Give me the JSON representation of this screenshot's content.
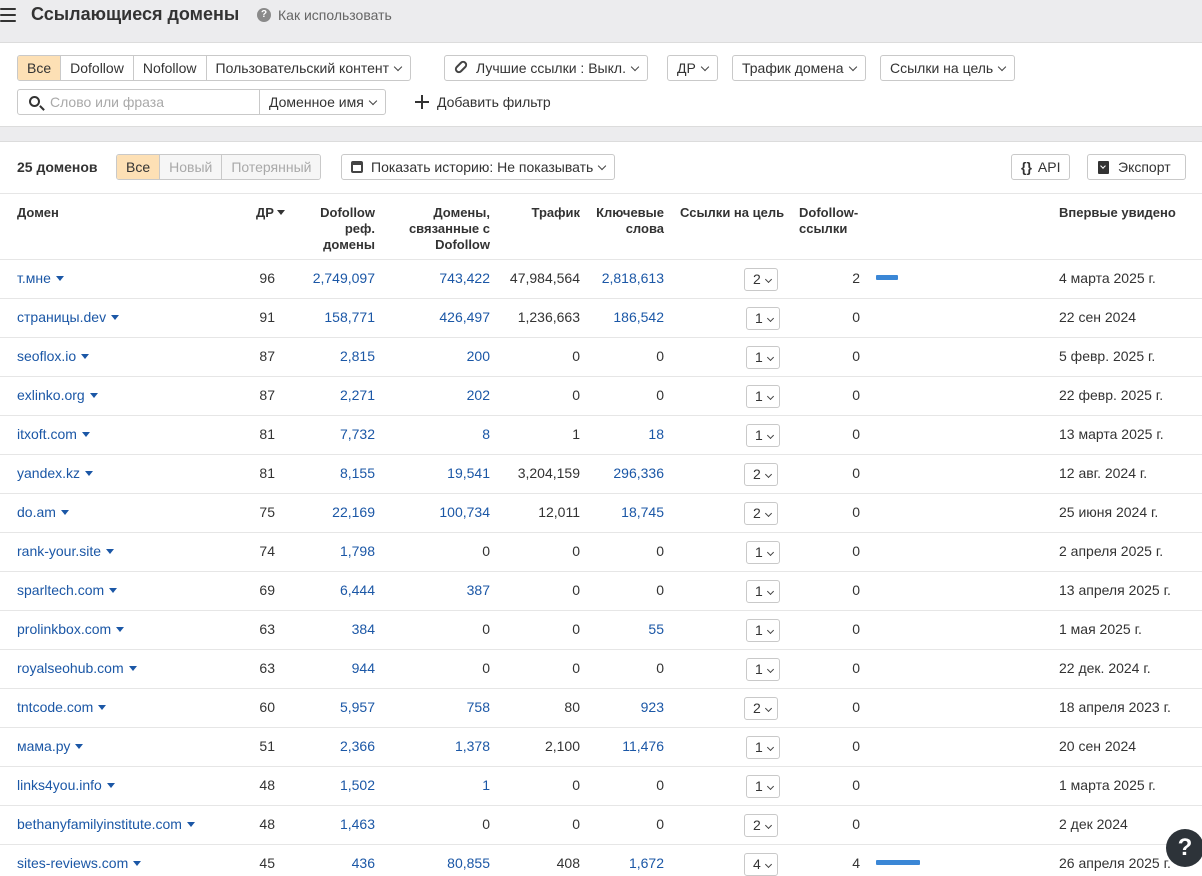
{
  "header": {
    "title": "Ссылающиеся домены",
    "help_text": "Как использовать",
    "help_icon": "?"
  },
  "filters": {
    "link_types": [
      "Все",
      "Dofollow",
      "Nofollow",
      "Пользовательский контент"
    ],
    "best_links": "Лучшие ссылки : Выкл.",
    "dr": "ДР",
    "domain_traffic": "Трафик домена",
    "links_to_target": "Ссылки на цель",
    "search_placeholder": "Слово или фраза",
    "search_scope": "Доменное имя",
    "add_filter": "Добавить фильтр"
  },
  "toolbar": {
    "count": "25 доменов",
    "states": [
      "Все",
      "Новый",
      "Потерянный"
    ],
    "history": "Показать историю: Не показывать",
    "api": "API",
    "api_icon": "{}",
    "export": "Экспорт"
  },
  "table": {
    "columns": {
      "domain": "Домен",
      "dr": "ДР",
      "dofollow_ref": "Dofollow\nреф.\nдомены",
      "linked_domains": "Домены,\nсвязанные с\nDofollow",
      "traffic": "Трафик",
      "keywords": "Ключевые\nслова",
      "links_to_target": "Ссылки на цель",
      "dofollow_links": "Dofollow-\nссылки",
      "first_seen": "Впервые увидено"
    },
    "rows": [
      {
        "domain": "т.мне",
        "dr": "96",
        "dofollow_ref": "2,749,097",
        "linked": "743,422",
        "traffic": "47,984,564",
        "keywords": "2,818,613",
        "links": "2",
        "dofollow": "2",
        "dofollow_share": 0.5,
        "first": "4 марта 2025 г."
      },
      {
        "domain": "страницы.dev",
        "dr": "91",
        "dofollow_ref": "158,771",
        "linked": "426,497",
        "traffic": "1,236,663",
        "keywords": "186,542",
        "links": "1",
        "dofollow": "0",
        "dofollow_share": 0,
        "first": "22 сен 2024"
      },
      {
        "domain": "seoflox.io",
        "dr": "87",
        "dofollow_ref": "2,815",
        "linked": "200",
        "traffic": "0",
        "keywords": "0",
        "links": "1",
        "dofollow": "0",
        "dofollow_share": 0,
        "first": "5 февр. 2025 г."
      },
      {
        "domain": "exlinko.org",
        "dr": "87",
        "dofollow_ref": "2,271",
        "linked": "202",
        "traffic": "0",
        "keywords": "0",
        "links": "1",
        "dofollow": "0",
        "dofollow_share": 0,
        "first": "22 февр. 2025 г."
      },
      {
        "domain": "itxoft.com",
        "dr": "81",
        "dofollow_ref": "7,732",
        "linked": "8",
        "traffic": "1",
        "keywords": "18",
        "links": "1",
        "dofollow": "0",
        "dofollow_share": 0,
        "first": "13 марта 2025 г."
      },
      {
        "domain": "yandex.kz",
        "dr": "81",
        "dofollow_ref": "8,155",
        "linked": "19,541",
        "traffic": "3,204,159",
        "keywords": "296,336",
        "links": "2",
        "dofollow": "0",
        "dofollow_share": 0,
        "first": "12 авг. 2024 г."
      },
      {
        "domain": "do.am",
        "dr": "75",
        "dofollow_ref": "22,169",
        "linked": "100,734",
        "traffic": "12,011",
        "keywords": "18,745",
        "links": "2",
        "dofollow": "0",
        "dofollow_share": 0,
        "first": "25 июня 2024 г."
      },
      {
        "domain": "rank-your.site",
        "dr": "74",
        "dofollow_ref": "1,798",
        "linked": "0",
        "traffic": "0",
        "keywords": "0",
        "links": "1",
        "dofollow": "0",
        "dofollow_share": 0,
        "first": "2 апреля 2025 г."
      },
      {
        "domain": "sparltech.com",
        "dr": "69",
        "dofollow_ref": "6,444",
        "linked": "387",
        "traffic": "0",
        "keywords": "0",
        "links": "1",
        "dofollow": "0",
        "dofollow_share": 0,
        "first": "13 апреля 2025 г."
      },
      {
        "domain": "prolinkbox.com",
        "dr": "63",
        "dofollow_ref": "384",
        "linked": "0",
        "traffic": "0",
        "keywords": "55",
        "links": "1",
        "dofollow": "0",
        "dofollow_share": 0,
        "first": "1 мая 2025 г."
      },
      {
        "domain": "royalseohub.com",
        "dr": "63",
        "dofollow_ref": "944",
        "linked": "0",
        "traffic": "0",
        "keywords": "0",
        "links": "1",
        "dofollow": "0",
        "dofollow_share": 0,
        "first": "22 дек. 2024 г."
      },
      {
        "domain": "tntcode.com",
        "dr": "60",
        "dofollow_ref": "5,957",
        "linked": "758",
        "traffic": "80",
        "keywords": "923",
        "links": "2",
        "dofollow": "0",
        "dofollow_share": 0,
        "first": "18 апреля 2023 г."
      },
      {
        "domain": "мама.ру",
        "dr": "51",
        "dofollow_ref": "2,366",
        "linked": "1,378",
        "traffic": "2,100",
        "keywords": "11,476",
        "links": "1",
        "dofollow": "0",
        "dofollow_share": 0,
        "first": "20 сен 2024"
      },
      {
        "domain": "links4you.info",
        "dr": "48",
        "dofollow_ref": "1,502",
        "linked": "1",
        "traffic": "0",
        "keywords": "0",
        "links": "1",
        "dofollow": "0",
        "dofollow_share": 0,
        "first": "1 марта 2025 г."
      },
      {
        "domain": "bethanyfamilyinstitute.com",
        "dr": "48",
        "dofollow_ref": "1,463",
        "linked": "0",
        "traffic": "0",
        "keywords": "0",
        "links": "2",
        "dofollow": "0",
        "dofollow_share": 0,
        "first": "2 дек 2024"
      },
      {
        "domain": "sites-reviews.com",
        "dr": "45",
        "dofollow_ref": "436",
        "linked": "80,855",
        "traffic": "408",
        "keywords": "1,672",
        "links": "4",
        "dofollow": "4",
        "dofollow_share": 1.0,
        "first": "26 апреля 2025 г."
      }
    ]
  },
  "help_bubble": "?",
  "colors": {
    "accent": "#fde0b5",
    "link": "#1b57a6",
    "bar": "#3b87d6"
  }
}
